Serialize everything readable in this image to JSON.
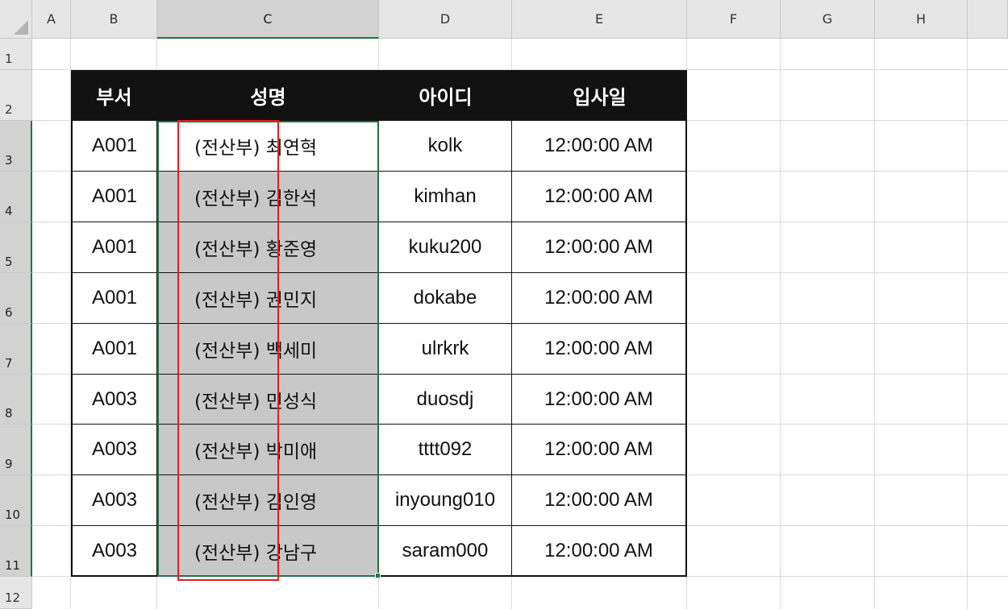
{
  "columns": [
    "A",
    "B",
    "C",
    "D",
    "E",
    "F",
    "G",
    "H"
  ],
  "rows": [
    "1",
    "2",
    "3",
    "4",
    "5",
    "6",
    "7",
    "8",
    "9",
    "10",
    "11",
    "12"
  ],
  "table": {
    "headers": [
      "부서",
      "성명",
      "아이디",
      "입사일"
    ],
    "rows": [
      {
        "dept": "A001",
        "name": "(전산부) 최연혁",
        "id": "kolk",
        "date": "12:00:00 AM"
      },
      {
        "dept": "A001",
        "name": "(전산부) 김한석",
        "id": "kimhan",
        "date": "12:00:00 AM"
      },
      {
        "dept": "A001",
        "name": "(전산부) 황준영",
        "id": "kuku200",
        "date": "12:00:00 AM"
      },
      {
        "dept": "A001",
        "name": "(전산부) 권민지",
        "id": "dokabe",
        "date": "12:00:00 AM"
      },
      {
        "dept": "A001",
        "name": "(전산부) 백세미",
        "id": "ulrkrk",
        "date": "12:00:00 AM"
      },
      {
        "dept": "A003",
        "name": "(전산부) 민성식",
        "id": "duosdj",
        "date": "12:00:00 AM"
      },
      {
        "dept": "A003",
        "name": "(전산부) 박미애",
        "id": "tttt092",
        "date": "12:00:00 AM"
      },
      {
        "dept": "A003",
        "name": "(전산부) 김인영",
        "id": "inyoung010",
        "date": "12:00:00 AM"
      },
      {
        "dept": "A003",
        "name": "(전산부) 강남구",
        "id": "saram000",
        "date": "12:00:00 AM"
      }
    ]
  },
  "colors": {
    "selection_border": "#217346",
    "highlight_box": "#e02020",
    "header_fill": "#111111",
    "selected_fill": "#c8c8c8"
  }
}
